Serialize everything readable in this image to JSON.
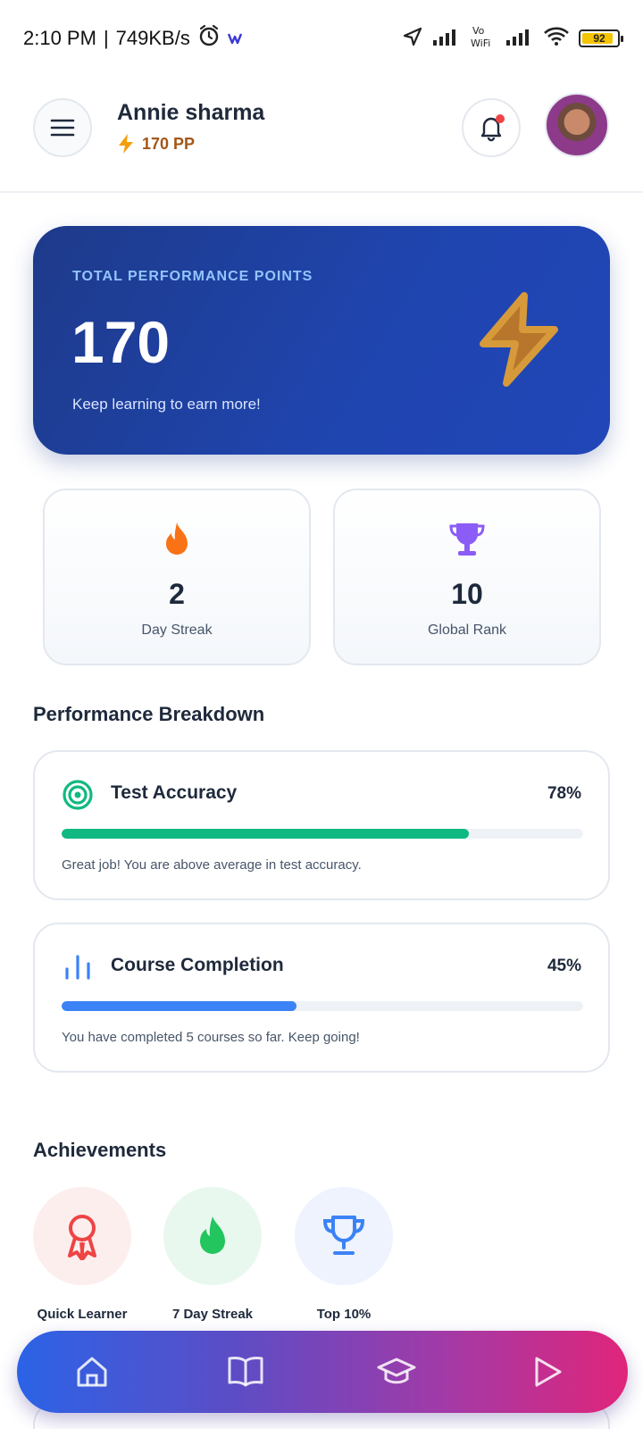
{
  "status_bar": {
    "time": "2:10 PM",
    "network_speed": "749KB/s",
    "battery": "92"
  },
  "header": {
    "user_name": "Annie sharma",
    "points": "170 PP"
  },
  "hero": {
    "label": "TOTAL PERFORMANCE POINTS",
    "value": "170",
    "subtitle": "Keep learning to earn more!"
  },
  "stats": [
    {
      "value": "2",
      "label": "Day Streak"
    },
    {
      "value": "10",
      "label": "Global Rank"
    }
  ],
  "breakdown": {
    "title": "Performance Breakdown",
    "items": [
      {
        "title": "Test Accuracy",
        "percent_label": "78%",
        "progress": 0.78,
        "note": "Great job! You are above average in test accuracy.",
        "color": "#10b981"
      },
      {
        "title": "Course Completion",
        "percent_label": "45%",
        "progress": 0.45,
        "note": "You have completed 5 courses so far. Keep going!",
        "color": "#3b82f6"
      }
    ]
  },
  "achievements": {
    "title": "Achievements",
    "items": [
      {
        "label": "Quick Learner",
        "icon": "award-ribbon-icon",
        "color": "#ef4444",
        "bg": "#fdeeee"
      },
      {
        "label": "7 Day Streak",
        "icon": "flame-icon",
        "color": "#22c55e",
        "bg": "#e9f8ee"
      },
      {
        "label": "Top 10%",
        "icon": "trophy-icon",
        "color": "#3b82f6",
        "bg": "#eef3fd"
      }
    ]
  },
  "bottom_nav": [
    "home-icon",
    "book-icon",
    "graduation-cap-icon",
    "play-icon"
  ]
}
